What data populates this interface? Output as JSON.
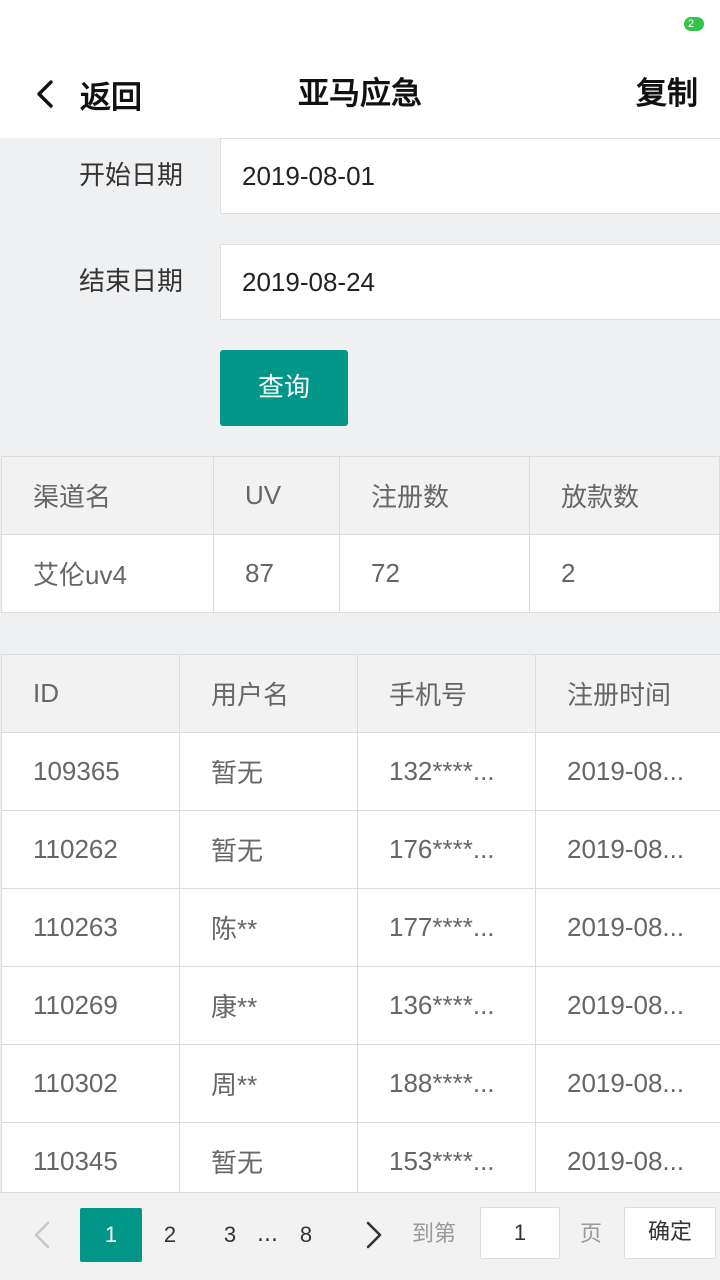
{
  "status_bar": {
    "badge": "2"
  },
  "header": {
    "back_label": "返回",
    "title": "亚马应急",
    "copy_label": "复制"
  },
  "form": {
    "start_label": "开始日期",
    "start_value": "2019-08-01",
    "end_label": "结束日期",
    "end_value": "2019-08-24",
    "query_label": "查询"
  },
  "summary": {
    "headers": [
      "渠道名",
      "UV",
      "注册数",
      "放款数"
    ],
    "row": [
      "艾伦uv4",
      "87",
      "72",
      "2"
    ]
  },
  "detail": {
    "headers": [
      "ID",
      "用户名",
      "手机号",
      "注册时间"
    ],
    "rows": [
      [
        "109365",
        "暂无",
        "132****...",
        "2019-08..."
      ],
      [
        "110262",
        "暂无",
        "176****...",
        "2019-08..."
      ],
      [
        "110263",
        "陈**",
        "177****...",
        "2019-08..."
      ],
      [
        "110269",
        "康**",
        "136****...",
        "2019-08..."
      ],
      [
        "110302",
        "周**",
        "188****...",
        "2019-08..."
      ],
      [
        "110345",
        "暂无",
        "153****...",
        "2019-08..."
      ]
    ]
  },
  "pager": {
    "pages": [
      "1",
      "2",
      "3"
    ],
    "ellipsis": "...",
    "last_page": "8",
    "goto_label": "到第",
    "goto_value": "1",
    "page_label": "页",
    "confirm_label": "确定"
  },
  "colors": {
    "accent": "#009688",
    "background": "#eff0f2"
  }
}
